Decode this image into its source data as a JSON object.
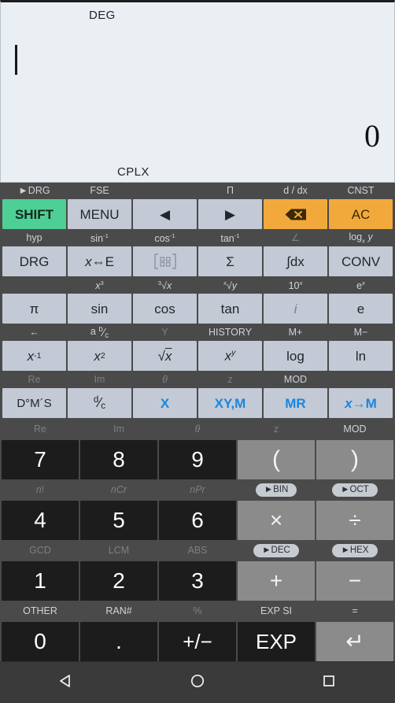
{
  "display": {
    "mode_top": "DEG",
    "mode_bottom": "CPLX",
    "entry": "",
    "result": "0"
  },
  "colors": {
    "shift": "#4ecf95",
    "clear": "#f2a93b",
    "key_face": "#c3cad6",
    "number_key": "#1c1c1c",
    "operator_key": "#8b8b8b",
    "memory_text": "#1787e0",
    "display_bg": "#eaeff3",
    "chassis": "#4a4a4a",
    "navbar": "#3a3a3a"
  },
  "sci_rows": [
    {
      "labels": [
        "►DRG",
        "FSE",
        "",
        "Π",
        "d / dx",
        "CNST"
      ],
      "label_dim": [
        false,
        false,
        false,
        false,
        false,
        false
      ],
      "keys": [
        {
          "label": "SHIFT",
          "style": "green",
          "name": "shift-key"
        },
        {
          "label": "MENU",
          "style": "",
          "name": "menu-key"
        },
        {
          "label": "◀",
          "style": "",
          "name": "cursor-left-key"
        },
        {
          "label": "▶",
          "style": "",
          "name": "cursor-right-key"
        },
        {
          "label": "backspace-icon",
          "style": "orange",
          "name": "backspace-key"
        },
        {
          "label": "AC",
          "style": "orange",
          "name": "all-clear-key"
        }
      ]
    },
    {
      "labels": [
        "hyp",
        "sin⁻¹",
        "cos⁻¹",
        "tan⁻¹",
        "∠",
        "logₓ y"
      ],
      "label_dim": [
        false,
        false,
        false,
        false,
        true,
        false
      ],
      "keys": [
        {
          "label": "DRG",
          "style": "",
          "name": "drg-key"
        },
        {
          "label": "x⇔E",
          "style": "",
          "name": "x-swap-e-key"
        },
        {
          "label": "matrix-icon",
          "style": "dimtext",
          "name": "matrix-key"
        },
        {
          "label": "Σ",
          "style": "",
          "name": "sigma-sum-key"
        },
        {
          "label": "∫dx",
          "style": "",
          "name": "integral-key"
        },
        {
          "label": "CONV",
          "style": "",
          "name": "convert-key"
        }
      ]
    },
    {
      "labels": [
        "",
        "x³",
        "³√x",
        "ˣ√y",
        "10ˣ",
        "eˣ"
      ],
      "label_dim": [
        false,
        false,
        false,
        false,
        false,
        false
      ],
      "keys": [
        {
          "label": "π",
          "style": "",
          "name": "pi-key"
        },
        {
          "label": "sin",
          "style": "",
          "name": "sin-key"
        },
        {
          "label": "cos",
          "style": "",
          "name": "cos-key"
        },
        {
          "label": "tan",
          "style": "",
          "name": "tan-key"
        },
        {
          "label": "i",
          "style": "dimtext",
          "name": "imaginary-unit-key"
        },
        {
          "label": "e",
          "style": "",
          "name": "euler-e-key"
        }
      ]
    },
    {
      "labels": [
        "←",
        "a b/c",
        "Y",
        "HISTORY",
        "M+",
        "M−"
      ],
      "label_dim": [
        false,
        false,
        true,
        false,
        false,
        false
      ],
      "keys": [
        {
          "label": "x⁻¹",
          "style": "",
          "name": "reciprocal-key"
        },
        {
          "label": "x²",
          "style": "",
          "name": "square-key"
        },
        {
          "label": "√x",
          "style": "",
          "name": "square-root-key"
        },
        {
          "label": "xʸ",
          "style": "",
          "name": "power-key"
        },
        {
          "label": "log",
          "style": "",
          "name": "log-key"
        },
        {
          "label": "ln",
          "style": "",
          "name": "ln-key"
        }
      ]
    },
    {
      "labels": [
        "Re",
        "Im",
        "θ",
        "z̄",
        "MOD",
        ""
      ],
      "label_dim": [
        true,
        true,
        true,
        true,
        false,
        false
      ],
      "keys": [
        {
          "label": "D°M´S",
          "style": "smalltext",
          "name": "degrees-minutes-seconds-key"
        },
        {
          "label": "d/c",
          "style": "",
          "name": "improper-fraction-key"
        },
        {
          "label": "X",
          "style": "bluetext",
          "name": "memory-x-key"
        },
        {
          "label": "XY,M",
          "style": "bluetext",
          "name": "memory-xym-key"
        },
        {
          "label": "MR",
          "style": "bluetext",
          "name": "memory-recall-key"
        },
        {
          "label": "x→M",
          "style": "bluetext",
          "name": "store-to-memory-key"
        }
      ]
    }
  ],
  "sci_row4_labels": [
    "←",
    "a b/c",
    "Y",
    "HISTORY",
    "M+",
    "M−"
  ],
  "num_section": [
    {
      "labels": [
        {
          "text": "Re",
          "dim": true,
          "pill": false
        },
        {
          "text": "Im",
          "dim": true,
          "pill": false
        },
        {
          "text": "θ",
          "dim": true,
          "pill": false
        },
        {
          "text": "z̄",
          "dim": true,
          "pill": false
        },
        {
          "text": "MOD",
          "dim": false,
          "pill": false
        }
      ],
      "keys": [
        {
          "label": "7",
          "style": "dark",
          "name": "digit-7-key"
        },
        {
          "label": "8",
          "style": "dark",
          "name": "digit-8-key"
        },
        {
          "label": "9",
          "style": "dark",
          "name": "digit-9-key"
        },
        {
          "label": "(",
          "style": "op paren",
          "name": "open-paren-key"
        },
        {
          "label": ")",
          "style": "op paren",
          "name": "close-paren-key"
        }
      ]
    },
    {
      "labels": [
        {
          "text": "n!",
          "dim": true,
          "pill": false
        },
        {
          "text": "nCr",
          "dim": true,
          "pill": false
        },
        {
          "text": "nPr",
          "dim": true,
          "pill": false
        },
        {
          "text": "►BIN",
          "dim": false,
          "pill": true
        },
        {
          "text": "►OCT",
          "dim": false,
          "pill": true
        }
      ],
      "keys": [
        {
          "label": "4",
          "style": "dark",
          "name": "digit-4-key"
        },
        {
          "label": "5",
          "style": "dark",
          "name": "digit-5-key"
        },
        {
          "label": "6",
          "style": "dark",
          "name": "digit-6-key"
        },
        {
          "label": "×",
          "style": "op",
          "name": "multiply-key"
        },
        {
          "label": "÷",
          "style": "op",
          "name": "divide-key"
        }
      ]
    },
    {
      "labels": [
        {
          "text": "GCD",
          "dim": true,
          "pill": false
        },
        {
          "text": "LCM",
          "dim": true,
          "pill": false
        },
        {
          "text": "ABS",
          "dim": true,
          "pill": false
        },
        {
          "text": "►DEC",
          "dim": false,
          "pill": true
        },
        {
          "text": "►HEX",
          "dim": false,
          "pill": true
        }
      ],
      "keys": [
        {
          "label": "1",
          "style": "dark",
          "name": "digit-1-key"
        },
        {
          "label": "2",
          "style": "dark",
          "name": "digit-2-key"
        },
        {
          "label": "3",
          "style": "dark",
          "name": "digit-3-key"
        },
        {
          "label": "+",
          "style": "op",
          "name": "add-key"
        },
        {
          "label": "−",
          "style": "op",
          "name": "subtract-key"
        }
      ]
    },
    {
      "labels": [
        {
          "text": "OTHER",
          "dim": false,
          "pill": false
        },
        {
          "text": "RAN#",
          "dim": false,
          "pill": false
        },
        {
          "text": "%",
          "dim": true,
          "pill": false
        },
        {
          "text": "EXP SI",
          "dim": false,
          "pill": false
        },
        {
          "text": "=",
          "dim": false,
          "pill": false
        }
      ],
      "keys": [
        {
          "label": "0",
          "style": "dark",
          "name": "digit-0-key"
        },
        {
          "label": ".",
          "style": "dark",
          "name": "decimal-point-key"
        },
        {
          "label": "+/−",
          "style": "dark exp",
          "name": "sign-toggle-key"
        },
        {
          "label": "EXP",
          "style": "dark exp",
          "name": "exponent-key"
        },
        {
          "label": "↵",
          "style": "op",
          "name": "enter-equals-key"
        }
      ]
    }
  ],
  "navbar": {
    "back": "back-triangle",
    "home": "home-circle",
    "recents": "recents-square"
  }
}
